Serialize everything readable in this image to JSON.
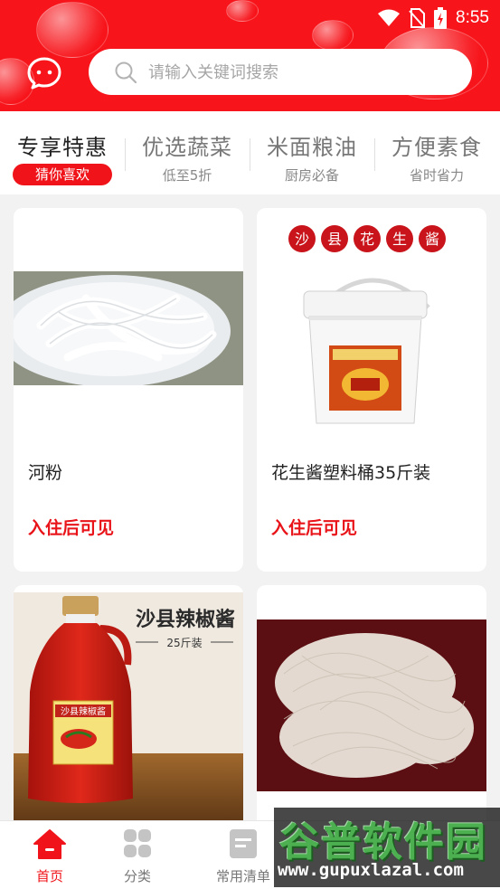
{
  "status_bar": {
    "time": "8:55"
  },
  "search": {
    "placeholder": "请输入关键词搜索"
  },
  "tabs": [
    {
      "title": "专享特惠",
      "subtitle": "猜你喜欢",
      "active": true
    },
    {
      "title": "优选蔬菜",
      "subtitle": "低至5折",
      "active": false
    },
    {
      "title": "米面粮油",
      "subtitle": "厨房必备",
      "active": false
    },
    {
      "title": "方便素食",
      "subtitle": "省时省力",
      "active": false
    }
  ],
  "products": [
    {
      "name": "河粉",
      "price_note": "入住后可见"
    },
    {
      "name": "花生酱塑料桶35斤装",
      "price_note": "入住后可见",
      "banner_text": "沙县花生酱"
    },
    {
      "name": "",
      "price_note": "",
      "banner_text": "沙县辣椒酱",
      "banner_sub": "25斤装",
      "label_text": "沙县辣椒酱"
    },
    {
      "name": "",
      "price_note": ""
    }
  ],
  "bottom_nav": [
    {
      "label": "首页",
      "icon": "home-icon",
      "active": true
    },
    {
      "label": "分类",
      "icon": "category-grid-icon",
      "active": false
    },
    {
      "label": "常用清单",
      "icon": "list-icon",
      "active": false
    }
  ],
  "watermark": {
    "title": "谷普软件园",
    "url": "www.gupuxlazal.com"
  },
  "colors": {
    "brand_red": "#f7141a",
    "price_red": "#e8141a"
  }
}
